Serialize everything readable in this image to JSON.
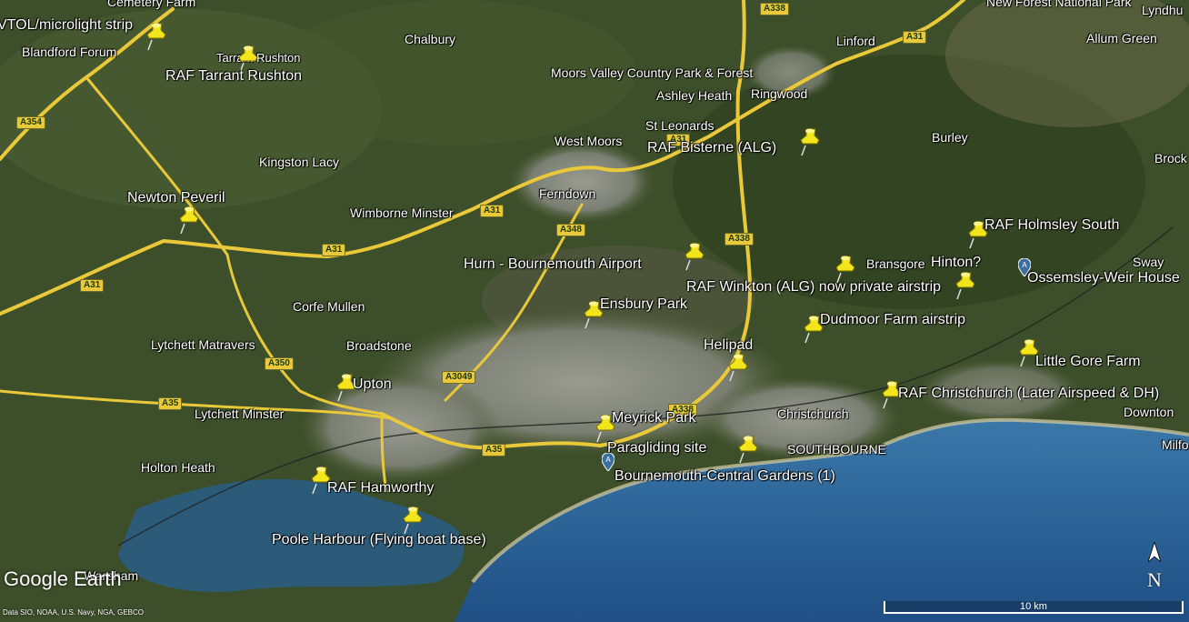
{
  "app": {
    "logo_text": "Google Earth",
    "credits": "Data SIO, NOAA, U.S. Navy, NGA, GEBCO"
  },
  "scale": {
    "label": "10 km"
  },
  "compass": {
    "letter": "N"
  },
  "colors": {
    "land": "#3d4f2a",
    "sea": "#2a5a86",
    "urban": "#8a8c82",
    "road": "#e9c93a",
    "pin": "#f2e51c"
  },
  "places": {
    "cemetery_farm": "Cemetery Farm",
    "blandford_forum": "Blandford Forum",
    "tarrant_rushton": "Tarrant Rushton",
    "chalbury": "Chalbury",
    "moors_valley": "Moors Valley Country Park & Forest",
    "linford": "Linford",
    "new_forest_park": "New Forest National Park",
    "lyndhurst": "Lyndhu",
    "allum_green": "Allum Green",
    "ashley_heath": "Ashley Heath",
    "ringwood": "Ringwood",
    "st_leonards": "St Leonards",
    "west_moors": "West Moors",
    "burley": "Burley",
    "brock": "Brock",
    "kingston_lacy": "Kingston Lacy",
    "ferndown": "Ferndown",
    "wimborne_minster": "Wimborne Minster",
    "bransgore": "Bransgore",
    "sway": "Sway",
    "corfe_mullen": "Corfe Mullen",
    "lytchett_matravers": "Lytchett Matravers",
    "broadstone": "Broadstone",
    "lytchett_minster": "Lytchett Minster",
    "christchurch": "Christchurch",
    "southbourne": "SOUTHBOURNE",
    "downton": "Downton",
    "milford": "Milfo",
    "holton_heath": "Holton Heath",
    "wareham": "Wareham"
  },
  "markers": [
    {
      "name": "VTOL/microlight strip"
    },
    {
      "name": "RAF Tarrant Rushton"
    },
    {
      "name": "Newton Peveril"
    },
    {
      "name": "RAF Bisterne (ALG)"
    },
    {
      "name": "RAF Holmsley South"
    },
    {
      "name": "Hurn - Bournemouth Airport"
    },
    {
      "name": "Hinton?"
    },
    {
      "name": "RAF Winkton (ALG) now private airstrip"
    },
    {
      "name": "Ossemsley-Weir House"
    },
    {
      "name": "Ensbury Park"
    },
    {
      "name": "Dudmoor Farm airstrip"
    },
    {
      "name": "Helipad"
    },
    {
      "name": "Little Gore Farm"
    },
    {
      "name": "Upton"
    },
    {
      "name": "RAF Christchurch (Later Airspeed & DH)"
    },
    {
      "name": "Meyrick Park"
    },
    {
      "name": "Paragliding site"
    },
    {
      "name": "Bournemouth-Central Gardens (1)"
    },
    {
      "name": "RAF Hamworthy"
    },
    {
      "name": "Poole Harbour (Flying boat base)"
    }
  ],
  "roads": {
    "a338_n": "A338",
    "a31_ne": "A31",
    "a354": "A354",
    "a31_mid": "A31",
    "a348": "A348",
    "a338_s": "A338",
    "a31_w": "A31",
    "a31_sw": "A31",
    "a350": "A350",
    "a3049": "A3049",
    "a35_w": "A35",
    "a35_e": "A35",
    "a31_top": "A31",
    "a338_c": "A338"
  }
}
